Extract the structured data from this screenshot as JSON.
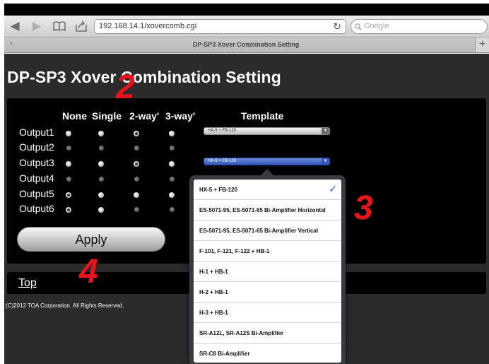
{
  "browser": {
    "url": "192.168.14.1/xovercomb.cgi",
    "search_placeholder": "Google",
    "tab_title": "DP-SP3 Xover Combination Setting",
    "tab_close": "×",
    "tab_plus": "+",
    "icons": [
      "back-arrow-icon",
      "forward-arrow-icon",
      "bookmarks-icon",
      "share-icon",
      "reload-icon",
      "search-icon"
    ]
  },
  "page": {
    "title": "DP-SP3 Xover Combination Setting",
    "columns": {
      "none": "None",
      "single": "Single",
      "two_way": "2-way'",
      "three_way": "3-way'",
      "template": "Template"
    },
    "rows": [
      {
        "label": "Output1",
        "template": "HX-5 + FB-120"
      },
      {
        "label": "Output2"
      },
      {
        "label": "Output3",
        "template": "HX-5 + FB-120"
      },
      {
        "label": "Output4"
      },
      {
        "label": "Output5"
      },
      {
        "label": "Output6"
      }
    ],
    "apply_label": "Apply",
    "top_link": "Top",
    "copyright": "(C)2012 TOA Corporation. All Rights Reserved."
  },
  "markers": {
    "m2": "2",
    "m3": "3",
    "m4": "4"
  },
  "dropdown": {
    "selected": "HX-5 + FB-120",
    "check": "✓",
    "options": [
      "HX-5 + FB-120",
      "ES-5071-95, ES-5071-65 Bi-Amplifier Horizontal",
      "ES-5071-95, ES-5071-65 Bi-Amplifier Vertical",
      "F-101, F-121, F-122 + HB-1",
      "H-1 + HB-1",
      "H-2 + HB-1",
      "H-3 + HB-1",
      "SR-A12L, SR-A12S Bi-Amplifier",
      "SR-C8 Bi-Amplifier"
    ]
  },
  "colors": {
    "marker": "#e8141b",
    "select_active": "#2f55b7",
    "check": "#2f5fbf"
  }
}
